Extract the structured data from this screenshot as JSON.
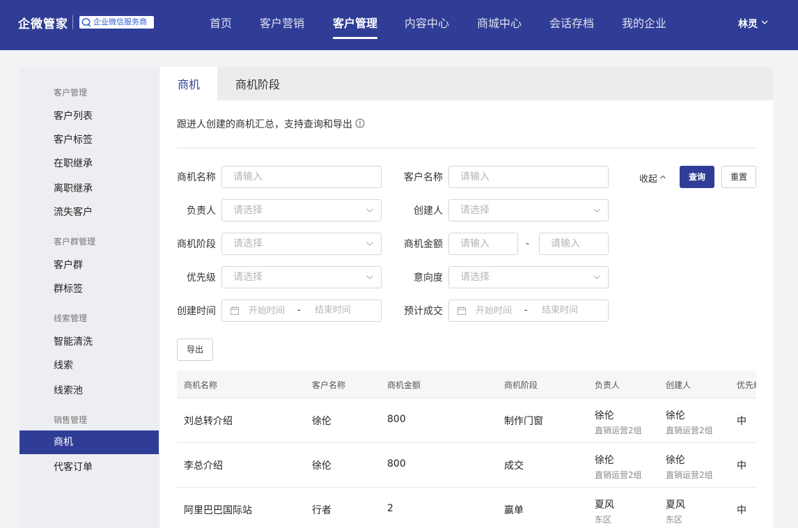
{
  "header": {
    "brand": "企微管家",
    "badge": "企业微信服务商",
    "nav": [
      "首页",
      "客户营销",
      "客户管理",
      "内容中心",
      "商城中心",
      "会话存档",
      "我的企业"
    ],
    "active_nav": "客户管理",
    "user": "林灵"
  },
  "sidebar": {
    "groups": [
      {
        "title": "客户管理",
        "items": [
          "客户列表",
          "客户标签",
          "在职继承",
          "离职继承",
          "流失客户"
        ]
      },
      {
        "title": "客户群管理",
        "items": [
          "客户群",
          "群标签"
        ]
      },
      {
        "title": "线索管理",
        "items": [
          "智能清洗",
          "线索",
          "线索池"
        ]
      },
      {
        "title": "销售管理",
        "items": [
          "商机",
          "代客订单"
        ]
      }
    ],
    "active_item": "商机"
  },
  "tabs": [
    "商机",
    "商机阶段"
  ],
  "description": "跟进人创建的商机汇总，支持查询和导出",
  "filters": {
    "opportunity_name": {
      "label": "商机名称",
      "placeholder": "请输入"
    },
    "customer_name": {
      "label": "客户名称",
      "placeholder": "请输入"
    },
    "owner": {
      "label": "负责人",
      "placeholder": "请选择"
    },
    "creator": {
      "label": "创建人",
      "placeholder": "请选择"
    },
    "stage": {
      "label": "商机阶段",
      "placeholder": "请选择"
    },
    "amount": {
      "label": "商机金额",
      "min_placeholder": "请输入",
      "max_placeholder": "请输入",
      "separator": "-"
    },
    "priority": {
      "label": "优先级",
      "placeholder": "请选择"
    },
    "intent": {
      "label": "意向度",
      "placeholder": "请选择"
    },
    "create_time": {
      "label": "创建时间",
      "start_placeholder": "开始时间",
      "end_placeholder": "结束时间",
      "separator": "-"
    },
    "expected_close": {
      "label": "预计成交",
      "start_placeholder": "开始时间",
      "end_placeholder": "结束时间",
      "separator": "-"
    }
  },
  "actions": {
    "collapse": "收起",
    "search": "查询",
    "reset": "重置",
    "export": "导出"
  },
  "table": {
    "columns": [
      "商机名称",
      "客户名称",
      "商机金额",
      "商机阶段",
      "负责人",
      "创建人",
      "优先级"
    ],
    "rows": [
      {
        "name": "刘总转介绍",
        "customer": "徐伦",
        "amount": "800",
        "stage": "制作门窗",
        "owner": "徐伦",
        "owner_dept": "直销运营2组",
        "creator": "徐伦",
        "creator_dept": "直销运营2组",
        "priority": "中"
      },
      {
        "name": "李总介绍",
        "customer": "徐伦",
        "amount": "800",
        "stage": "成交",
        "owner": "徐伦",
        "owner_dept": "直销运营2组",
        "creator": "徐伦",
        "creator_dept": "直销运营2组",
        "priority": "中"
      },
      {
        "name": "阿里巴巴国际站",
        "customer": "行者",
        "amount": "2",
        "stage": "赢单",
        "owner": "夏风",
        "owner_dept": "东区",
        "creator": "夏风",
        "creator_dept": "东区",
        "priority": "中"
      }
    ]
  },
  "colors": {
    "primary": "#2f3d96",
    "page_bg": "#f2f3f5",
    "sidebar_bg": "#edeef1"
  }
}
